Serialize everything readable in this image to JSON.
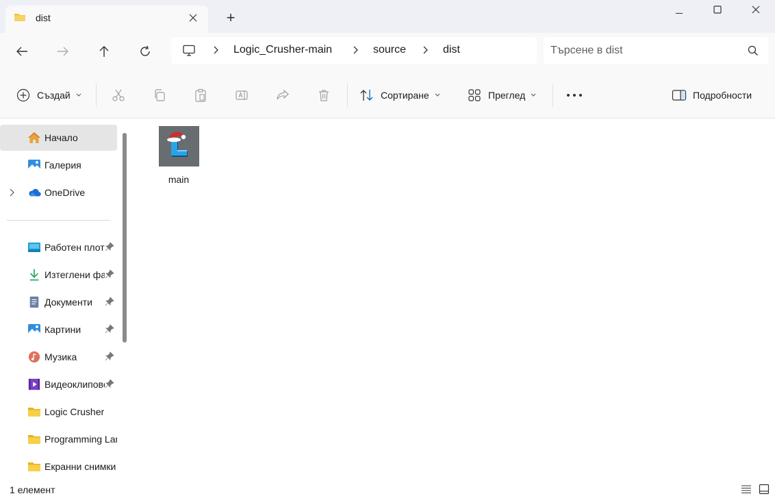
{
  "tab": {
    "title": "dist"
  },
  "window": {
    "new_tab": "+"
  },
  "breadcrumb": [
    "Logic_Crusher-main",
    "source",
    "dist"
  ],
  "search": {
    "placeholder": "Търсене в dist"
  },
  "commands": {
    "create": "Създай",
    "sort": "Сортиране",
    "view": "Преглед",
    "details": "Подробности"
  },
  "sidebar": {
    "top_items": [
      {
        "label": "Начало",
        "icon": "home-icon",
        "selected": true
      },
      {
        "label": "Галерия",
        "icon": "gallery-icon"
      },
      {
        "label": "OneDrive",
        "icon": "cloud-icon",
        "expandable": true
      }
    ],
    "quick_access": [
      {
        "label": "Работен плот",
        "icon": "desktop-icon",
        "pinned": true
      },
      {
        "label": "Изтеглени файлове",
        "icon": "download-icon",
        "pinned": true
      },
      {
        "label": "Документи",
        "icon": "document-icon",
        "pinned": true
      },
      {
        "label": "Картини",
        "icon": "pictures-icon",
        "pinned": true
      },
      {
        "label": "Музика",
        "icon": "music-icon",
        "pinned": true
      },
      {
        "label": "Видеоклипове",
        "icon": "video-icon",
        "pinned": true
      },
      {
        "label": "Logic Crusher",
        "icon": "folder-icon"
      },
      {
        "label": "Programming Language",
        "icon": "folder-icon"
      },
      {
        "label": "Екранни снимки",
        "icon": "folder-icon"
      }
    ]
  },
  "files": [
    {
      "name": "main",
      "icon": "logic-crusher-app-icon",
      "thumb_letter": "L"
    }
  ],
  "status": {
    "count_text": "1 елемент"
  },
  "colors": {
    "folder": "#f4c542",
    "accent": "#0067c0",
    "app_letter": "#29a3e8",
    "santa_hat": "#d62b2b"
  }
}
